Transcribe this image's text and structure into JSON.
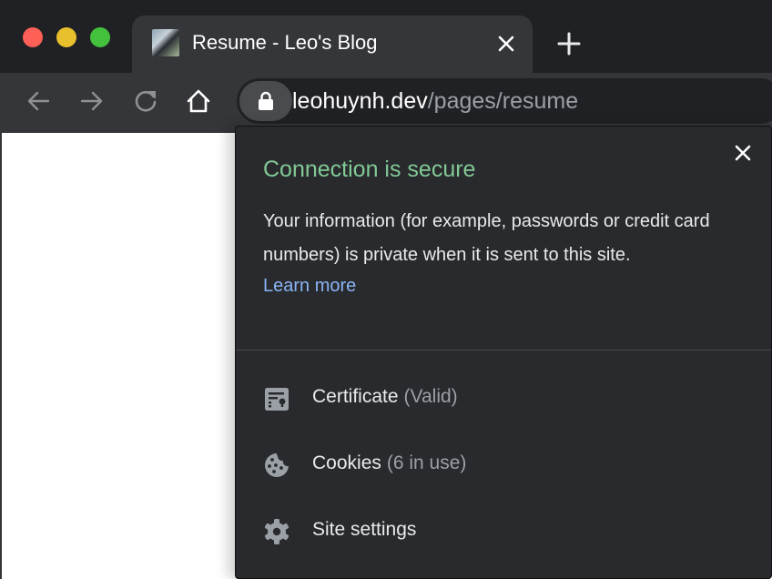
{
  "window": {
    "traffic_lights": [
      "close",
      "minimize",
      "maximize"
    ]
  },
  "tabs": [
    {
      "title": "Resume - Leo's Blog",
      "favicon": "profile-photo",
      "close_icon": "close-icon",
      "active": true
    }
  ],
  "new_tab_icon": "plus-icon",
  "toolbar": {
    "back_icon": "arrow-left-icon",
    "forward_icon": "arrow-right-icon",
    "reload_icon": "reload-icon",
    "home_icon": "home-icon"
  },
  "omnibox": {
    "security_icon": "lock-icon",
    "host": "leohuynh.dev",
    "path": "/pages/resume"
  },
  "site_info_popup": {
    "title": "Connection is secure",
    "description": "Your information (for example, passwords or credit card numbers) is private when it is sent to this site.",
    "learn_more": "Learn more",
    "close_icon": "close-icon",
    "items": [
      {
        "icon": "certificate-icon",
        "label": "Certificate",
        "sub": "(Valid)"
      },
      {
        "icon": "cookie-icon",
        "label": "Cookies",
        "sub": "(6 in use)"
      },
      {
        "icon": "gear-icon",
        "label": "Site settings",
        "sub": ""
      }
    ]
  },
  "colors": {
    "secure_green": "#81c995",
    "link_blue": "#8ab4f8",
    "popup_bg": "#292a2d",
    "frame_bg": "#202124",
    "toolbar_bg": "#35363a"
  }
}
